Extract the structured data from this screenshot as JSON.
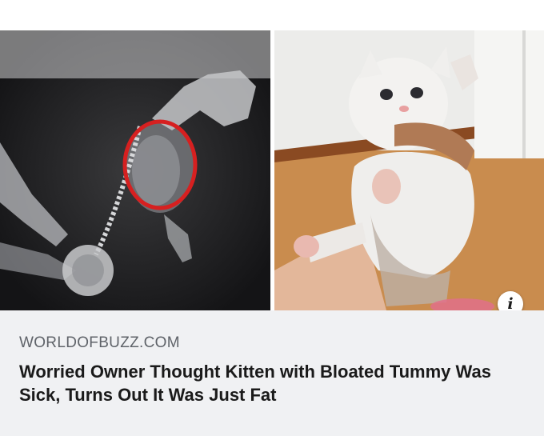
{
  "link_preview": {
    "domain": "WORLDOFBUZZ.COM",
    "headline": "Worried Owner Thought Kitten with Bloated Tummy Was Sick, Turns Out It Was Just Fat",
    "info_button_glyph": "i"
  },
  "images": {
    "left": "x-ray-of-kitten",
    "right": "white-kitten-held-up"
  },
  "colors": {
    "highlight_circle": "#d62020",
    "caption_background": "#f0f1f3"
  }
}
